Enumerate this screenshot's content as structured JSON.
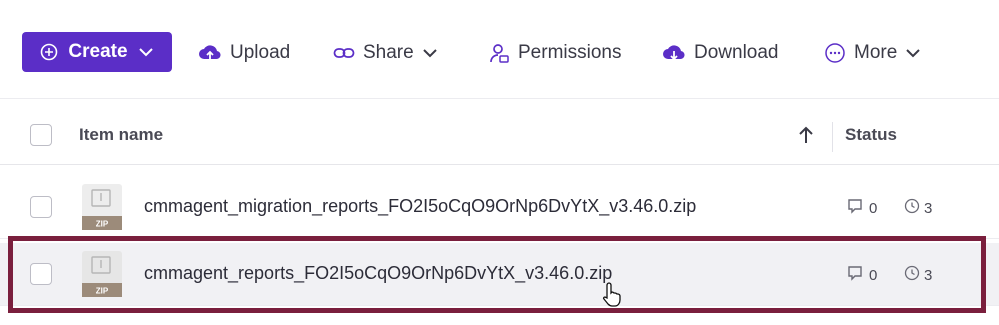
{
  "toolbar": {
    "create_label": "Create",
    "upload_label": "Upload",
    "share_label": "Share",
    "permissions_label": "Permissions",
    "download_label": "Download",
    "more_label": "More"
  },
  "table": {
    "columns": {
      "name": "Item name",
      "status": "Status"
    },
    "rows": [
      {
        "name": "cmmagent_migration_reports_FO2I5oCqO9OrNp6DvYtX_v3.46.0.zip",
        "file_type": "ZIP",
        "comments": "0",
        "versions": "3"
      },
      {
        "name": "cmmagent_reports_FO2I5oCqO9OrNp6DvYtX_v3.46.0.zip",
        "file_type": "ZIP",
        "comments": "0",
        "versions": "3"
      }
    ]
  },
  "colors": {
    "accent": "#5b2ec7",
    "highlight": "#7a1f3d",
    "file_badge": "#9c8b7a"
  }
}
